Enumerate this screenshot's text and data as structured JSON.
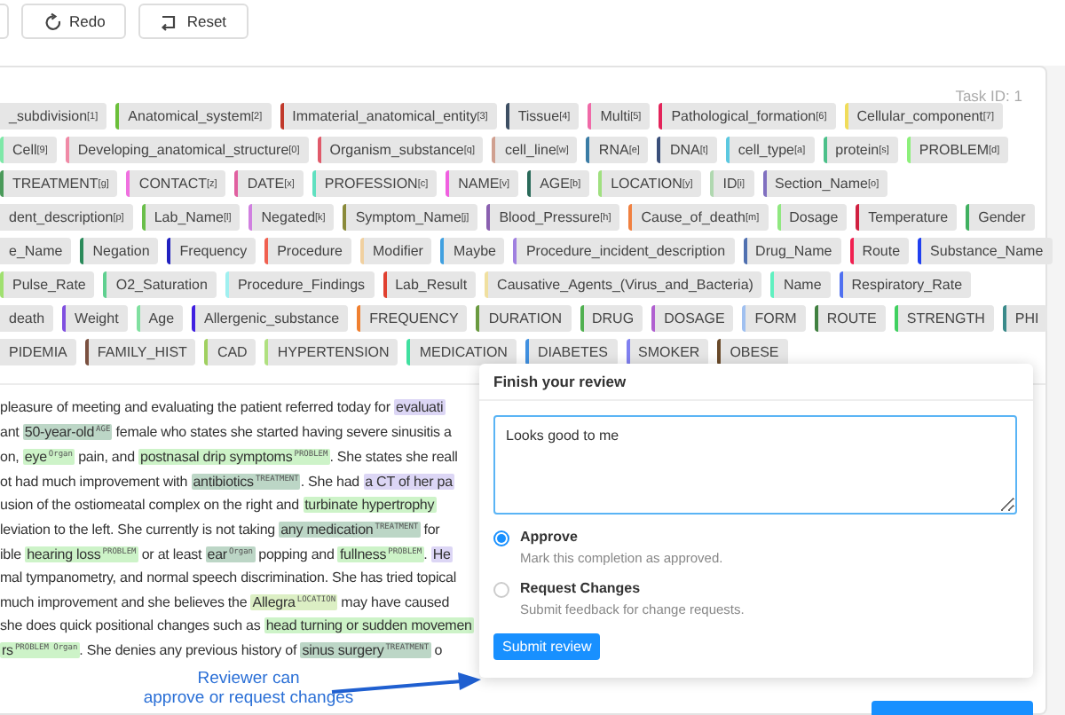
{
  "toolbar": {
    "buttons": [
      {
        "label": "Redo",
        "kind": "redo"
      },
      {
        "label": "Reset",
        "kind": "reset"
      }
    ]
  },
  "task_id": "Task ID: 1",
  "label_rows": [
    [
      {
        "text": "_subdivision",
        "key": "[1]"
      },
      {
        "text": "Anatomical_system",
        "key": "[2]",
        "color": "#6bbf3a"
      },
      {
        "text": "Immaterial_anatomical_entity",
        "key": "[3]",
        "color": "#c0392b"
      },
      {
        "text": "Tissue",
        "key": "[4]",
        "color": "#3d4f63"
      },
      {
        "text": "Multi",
        "key": "[5]",
        "color": "#f06aa8"
      },
      {
        "text": "Pathological_formation",
        "key": "[6]",
        "color": "#e3245a"
      },
      {
        "text": "Cellular_component",
        "key": "[7]",
        "color": "#f0dc5a"
      }
    ],
    [
      {
        "text": "Cell",
        "key": "[9]",
        "color": "#7ee8a8"
      },
      {
        "text": "Developing_anatomical_structure",
        "key": "[0]",
        "color": "#f08aa6"
      },
      {
        "text": "Organism_substance",
        "key": "[q]",
        "color": "#e05a6a"
      },
      {
        "text": "cell_line",
        "key": "[w]",
        "color": "#d0a090"
      },
      {
        "text": "RNA",
        "key": "[e]",
        "color": "#3a7ca5"
      },
      {
        "text": "DNA",
        "key": "[t]",
        "color": "#3a4f7a"
      },
      {
        "text": "cell_type",
        "key": "[a]",
        "color": "#5bc8e0"
      },
      {
        "text": "protein",
        "key": "[s]",
        "color": "#4cc08a"
      },
      {
        "text": "PROBLEM",
        "key": "[d]",
        "color": "#8cf07a"
      }
    ],
    [
      {
        "text": "TREATMENT",
        "key": "[g]",
        "color": "#4a9a5a"
      },
      {
        "text": "CONTACT",
        "key": "[z]",
        "color": "#f070e0"
      },
      {
        "text": "DATE",
        "key": "[x]",
        "color": "#e060a0"
      },
      {
        "text": "PROFESSION",
        "key": "[c]",
        "color": "#60e0c0"
      },
      {
        "text": "NAME",
        "key": "[v]",
        "color": "#f060e0"
      },
      {
        "text": "AGE",
        "key": "[b]",
        "color": "#2a6a5a"
      },
      {
        "text": "LOCATION",
        "key": "[y]",
        "color": "#a0e080"
      },
      {
        "text": "ID",
        "key": "[i]",
        "color": "#b0d8b0"
      },
      {
        "text": "Section_Name",
        "key": "[o]",
        "color": "#8070c0"
      }
    ],
    [
      {
        "text": "dent_description",
        "key": "[p]"
      },
      {
        "text": "Lab_Name",
        "key": "[l]",
        "color": "#6abf4a"
      },
      {
        "text": "Negated",
        "key": "[k]",
        "color": "#d080e0"
      },
      {
        "text": "Symptom_Name",
        "key": "[j]",
        "color": "#8a8a3a"
      },
      {
        "text": "Blood_Pressure",
        "key": "[h]",
        "color": "#8a60b0"
      },
      {
        "text": "Cause_of_death",
        "key": "[m]",
        "color": "#f08040"
      },
      {
        "text": "Dosage",
        "color": "#90e880"
      },
      {
        "text": "Temperature",
        "color": "#d02040"
      },
      {
        "text": "Gender",
        "color": "#40b060"
      }
    ],
    [
      {
        "text": "e_Name"
      },
      {
        "text": "Negation",
        "color": "#2a8a5a"
      },
      {
        "text": "Frequency",
        "color": "#2020c0"
      },
      {
        "text": "Procedure",
        "color": "#f06050"
      },
      {
        "text": "Modifier",
        "color": "#f0d0a0"
      },
      {
        "text": "Maybe",
        "color": "#40a0e0"
      },
      {
        "text": "Procedure_incident_description",
        "color": "#a080e0"
      },
      {
        "text": "Drug_Name",
        "color": "#5070b0"
      },
      {
        "text": "Route",
        "color": "#f02050"
      },
      {
        "text": "Substance_Name",
        "color": "#2040f0"
      }
    ],
    [
      {
        "text": "Pulse_Rate",
        "color": "#a0e070"
      },
      {
        "text": "O2_Saturation",
        "color": "#60d090"
      },
      {
        "text": "Procedure_Findings",
        "color": "#a0f0f0"
      },
      {
        "text": "Lab_Result",
        "color": "#e04030"
      },
      {
        "text": "Causative_Agents_(Virus_and_Bacteria)",
        "color": "#f0e0a0"
      },
      {
        "text": "Name",
        "color": "#60f0c0"
      },
      {
        "text": "Respiratory_Rate",
        "color": "#5070f0"
      }
    ],
    [
      {
        "text": "death"
      },
      {
        "text": "Weight",
        "color": "#8050e0"
      },
      {
        "text": "Age",
        "color": "#80e0a0"
      },
      {
        "text": "Allergenic_substance",
        "color": "#4020e0"
      },
      {
        "text": "FREQUENCY",
        "color": "#f08030"
      },
      {
        "text": "DURATION",
        "color": "#6a9a40"
      },
      {
        "text": "DRUG",
        "color": "#50b050"
      },
      {
        "text": "DOSAGE",
        "color": "#b060d0"
      },
      {
        "text": "FORM",
        "color": "#a0c0f0"
      },
      {
        "text": "ROUTE",
        "color": "#408040"
      },
      {
        "text": "STRENGTH",
        "color": "#40d060"
      },
      {
        "text": "PHI",
        "color": "#3a8a8a"
      }
    ],
    [
      {
        "text": "PIDEMIA"
      },
      {
        "text": "FAMILY_HIST",
        "color": "#7a5040"
      },
      {
        "text": "CAD",
        "color": "#a0d060"
      },
      {
        "text": "HYPERTENSION",
        "color": "#b0e080"
      },
      {
        "text": "MEDICATION",
        "color": "#40e0a0"
      },
      {
        "text": "DIABETES",
        "color": "#4090e0"
      },
      {
        "text": "SMOKER",
        "color": "#8080f0"
      },
      {
        "text": "OBESE",
        "color": "#6a4a2a"
      }
    ]
  ],
  "document": {
    "lines": [
      [
        {
          "text": "pleasure of meeting and evaluating the patient referred today for "
        },
        {
          "text": "evaluati",
          "color": "#dcd6f5"
        }
      ],
      [
        {
          "text": "ant "
        },
        {
          "text": "50-year-old",
          "label": "AGE",
          "color": "#bcd6c6"
        },
        {
          "text": " female who states she started having severe sinusitis a"
        }
      ],
      [
        {
          "text": "on, "
        },
        {
          "text": "eye",
          "label": "Organ",
          "color": "#cdf3c8"
        },
        {
          "text": " pain, and "
        },
        {
          "text": "postnasal drip symptoms",
          "label": "PROBLEM",
          "color": "#cdf3c8"
        },
        {
          "text": ". She states she reall"
        }
      ],
      [
        {
          "text": "ot had much improvement with "
        },
        {
          "text": "antibiotics",
          "label": "TREATMENT",
          "color": "#bcd6c6"
        },
        {
          "text": ". She had "
        },
        {
          "text": "a CT of her pa",
          "color": "#dcd6f5"
        }
      ],
      [
        {
          "text": "usion of the ostiomeatal complex on the right and "
        },
        {
          "text": "turbinate hypertrophy",
          "color": "#cdf3c8"
        }
      ],
      [
        {
          "text": "leviation to the left. She currently is not taking "
        },
        {
          "text": "any medication",
          "label": "TREATMENT",
          "color": "#bcd6c6"
        },
        {
          "text": " for"
        }
      ],
      [
        {
          "text": "ible "
        },
        {
          "text": "hearing loss",
          "label": "PROBLEM",
          "color": "#cdf3c8"
        },
        {
          "text": " or at least "
        },
        {
          "text": "ear",
          "label": "Organ",
          "color": "#bcd6c6"
        },
        {
          "text": " popping and "
        },
        {
          "text": "fullness",
          "label": "PROBLEM",
          "color": "#cdf3c8"
        },
        {
          "text": ". "
        },
        {
          "text": "He",
          "color": "#dcd6f5"
        }
      ],
      [
        {
          "text": "mal tympanometry, and normal speech discrimination. She has tried topical"
        }
      ],
      [
        {
          "text": "much improvement and she believes the "
        },
        {
          "text": "Allegra",
          "label": "LOCATION",
          "color": "#dcefc4"
        },
        {
          "text": " may have caused"
        }
      ],
      [
        {
          "text": "she does quick positional changes such as "
        },
        {
          "text": "head turning or sudden movemen",
          "color": "#cdf3c8"
        }
      ],
      [
        {
          "text": "rs",
          "label": "PROBLEM Organ",
          "color": "#cdf3c8"
        },
        {
          "text": ". She denies any previous history of "
        },
        {
          "text": "sinus surgery",
          "label": "TREATMENT",
          "color": "#bcd6c6"
        },
        {
          "text": " o"
        }
      ]
    ]
  },
  "review": {
    "title": "Finish your review",
    "comment": "Looks good to me",
    "options": [
      {
        "label": "Approve",
        "description": "Mark this completion as approved.",
        "selected": true
      },
      {
        "label": "Request Changes",
        "description": "Submit feedback for change requests.",
        "selected": false
      }
    ],
    "submit": "Submit review"
  },
  "annotation": {
    "lines": [
      "Reviewer can",
      "approve or request changes"
    ]
  }
}
